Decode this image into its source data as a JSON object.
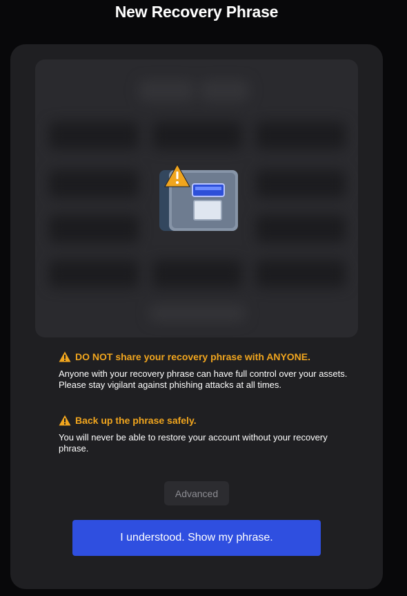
{
  "page": {
    "title": "New Recovery Phrase"
  },
  "warnings": [
    {
      "icon": "warning-icon",
      "heading": "DO NOT share your recovery phrase with ANYONE.",
      "body": "Anyone with your recovery phrase can have full control over your assets. Please stay vigilant against phishing attacks at all times."
    },
    {
      "icon": "warning-icon",
      "heading": "Back up the phrase safely.",
      "body": "You will never be able to restore your account without your recovery phrase."
    }
  ],
  "buttons": {
    "advanced_label": "Advanced",
    "primary_label": "I understood. Show my phrase."
  },
  "colors": {
    "background": "#08080a",
    "card": "#1f1f22",
    "warning": "#f0a51e",
    "primary": "#2f4fe0"
  }
}
